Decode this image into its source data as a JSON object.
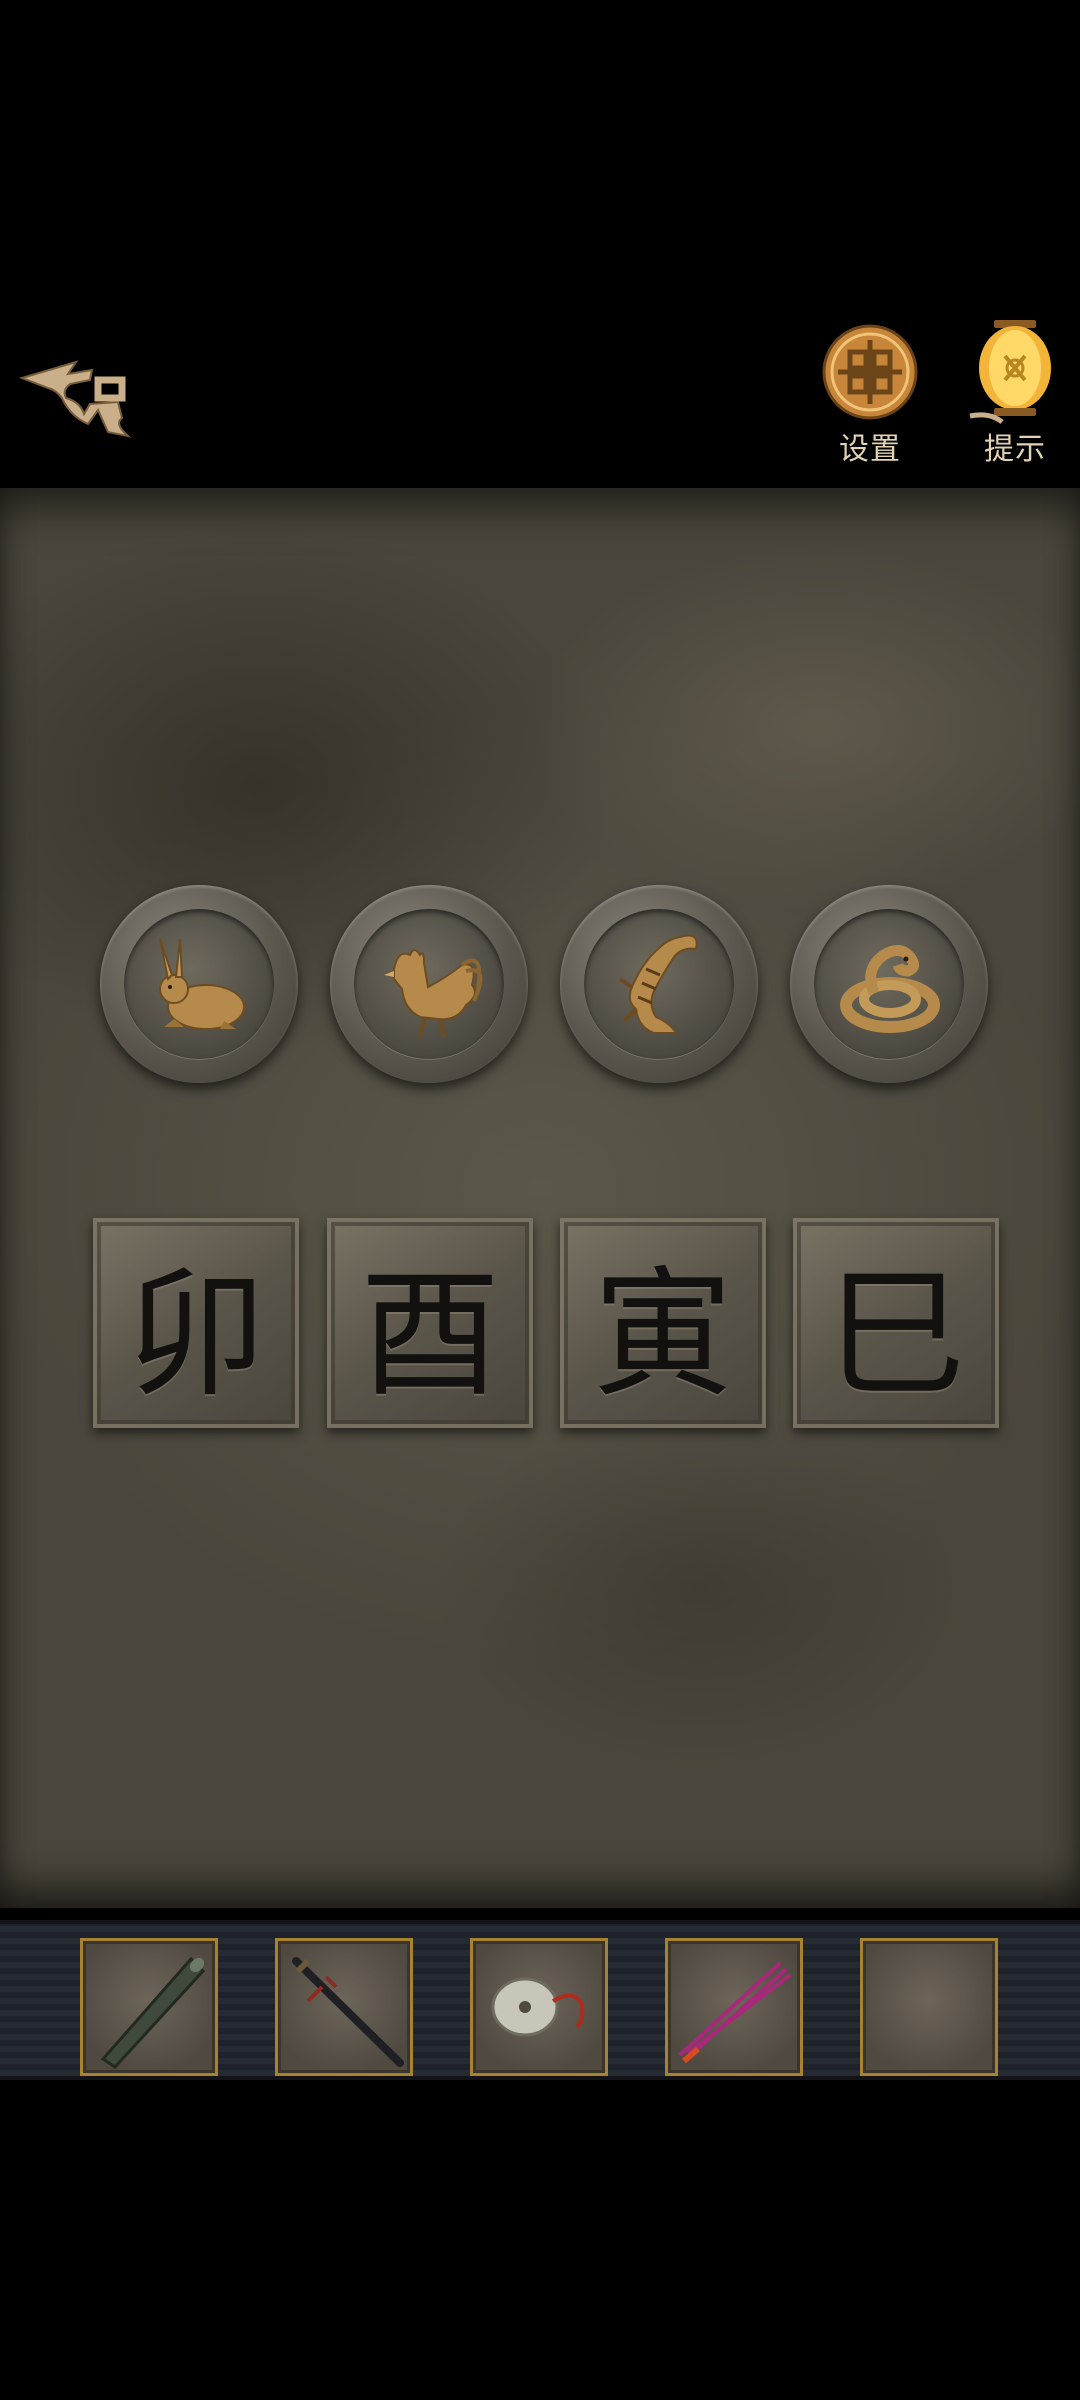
{
  "header": {
    "settings_label": "设置",
    "hint_label": "提示"
  },
  "puzzle": {
    "medallions": [
      {
        "animal": "rabbit"
      },
      {
        "animal": "rooster"
      },
      {
        "animal": "tiger"
      },
      {
        "animal": "snake"
      }
    ],
    "seals": [
      {
        "glyph": "卯"
      },
      {
        "glyph": "酉"
      },
      {
        "glyph": "寅"
      },
      {
        "glyph": "巳"
      }
    ]
  },
  "inventory": {
    "slots": [
      {
        "item": "wooden-tube-icon"
      },
      {
        "item": "sword-icon"
      },
      {
        "item": "jade-disc-icon"
      },
      {
        "item": "incense-sticks-icon"
      },
      {
        "item": "empty"
      }
    ]
  },
  "colors": {
    "gold": "#c88a3a",
    "label": "#e4d3b0",
    "stage": "#4f4b40",
    "slot_border": "#a8832f"
  }
}
